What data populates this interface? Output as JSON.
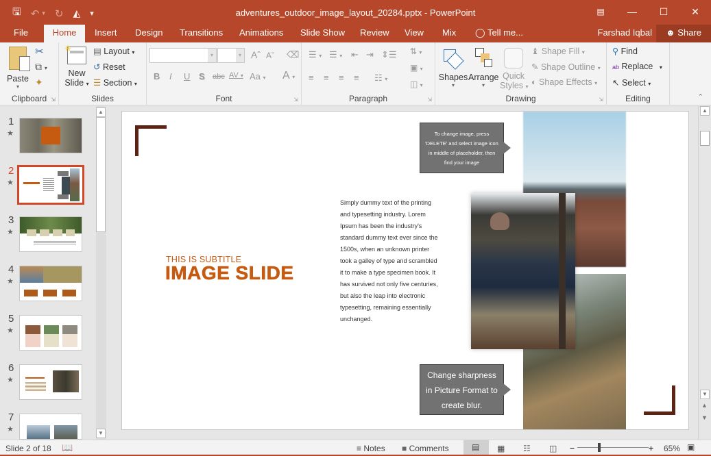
{
  "window": {
    "title": "adventures_outdoor_image_layout_20284.pptx - PowerPoint",
    "qat": [
      {
        "name": "save-icon",
        "glyph": "🖫"
      },
      {
        "name": "undo-icon",
        "glyph": "↶"
      },
      {
        "name": "undo-dropdown-icon",
        "glyph": "▾"
      },
      {
        "name": "redo-icon",
        "glyph": "↻"
      },
      {
        "name": "present-from-start-icon",
        "glyph": "⊡"
      },
      {
        "name": "customize-qat-icon",
        "glyph": "⩡"
      }
    ],
    "controls": {
      "ribbon_display": "⊼",
      "minimize": "—",
      "maximize": "☐",
      "close": "✕"
    }
  },
  "tabs": [
    {
      "label": "File"
    },
    {
      "label": "Home",
      "active": true
    },
    {
      "label": "Insert"
    },
    {
      "label": "Design"
    },
    {
      "label": "Transitions"
    },
    {
      "label": "Animations"
    },
    {
      "label": "Slide Show"
    },
    {
      "label": "Review"
    },
    {
      "label": "View"
    },
    {
      "label": "Mix"
    },
    {
      "label": "Tell me...",
      "icon": "lightbulb-icon"
    }
  ],
  "user": {
    "name": "Farshad Iqbal",
    "share_label": "Share"
  },
  "ribbon": {
    "clipboard": {
      "label": "Clipboard",
      "paste": "Paste"
    },
    "slides": {
      "label": "Slides",
      "new_slide_1": "New",
      "new_slide_2": "Slide",
      "layout": "Layout",
      "reset": "Reset",
      "section": "Section"
    },
    "font": {
      "label": "Font",
      "font_name": "",
      "font_size": "",
      "bold": "B",
      "italic": "I",
      "underline": "U",
      "shadow": "S",
      "strike": "abc",
      "spacing": "AV",
      "case": "Aa",
      "color": "A"
    },
    "paragraph": {
      "label": "Paragraph"
    },
    "drawing": {
      "label": "Drawing",
      "shapes": "Shapes",
      "arrange": "Arrange",
      "quick_styles_1": "Quick",
      "quick_styles_2": "Styles",
      "shape_fill": "Shape Fill",
      "shape_outline": "Shape Outline",
      "shape_effects": "Shape Effects"
    },
    "editing": {
      "label": "Editing",
      "find": "Find",
      "replace": "Replace",
      "select": "Select"
    }
  },
  "thumbnails": [
    {
      "num": "1"
    },
    {
      "num": "2",
      "selected": true
    },
    {
      "num": "3"
    },
    {
      "num": "4"
    },
    {
      "num": "5"
    },
    {
      "num": "6"
    },
    {
      "num": "7"
    }
  ],
  "slide": {
    "subtitle": "THIS IS SUBTITLE",
    "title": "IMAGE SLIDE",
    "body": "Simply dummy text of the printing and typesetting industry. Lorem Ipsum has been the industry's standard dummy text ever since the 1500s, when an unknown printer took a galley of type and scrambled it to make a type specimen book. It has survived not only five centuries, but also the leap into electronic typesetting, remaining essentially unchanged.",
    "callout_top": "To change image, press 'DELETE' and select image icon in middle of placeholder, then find your image",
    "callout_bottom": "Change sharpness in Picture Format to create blur.",
    "accent_color": "#c55a11",
    "corner_color": "#5c2214"
  },
  "status": {
    "slide_info": "Slide 2 of 18",
    "notes": "Notes",
    "comments": "Comments",
    "zoom": "65%"
  }
}
